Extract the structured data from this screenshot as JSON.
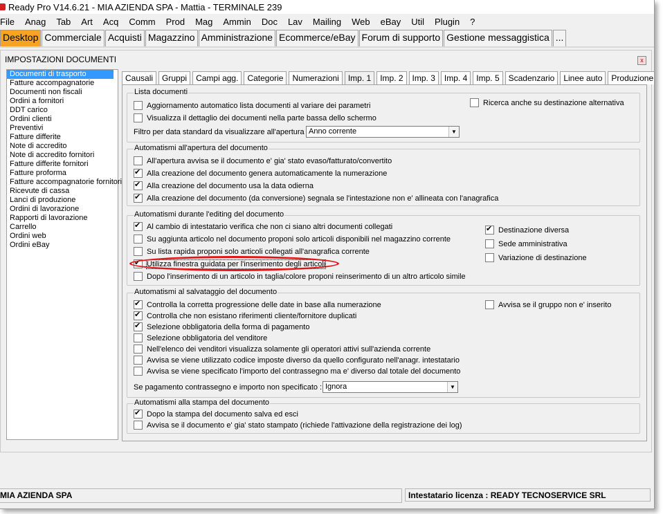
{
  "window": {
    "title": "Ready Pro V14.6.21 - MIA AZIENDA SPA - Mattia - TERMINALE 239"
  },
  "menu": [
    "File",
    "Anag",
    "Tab",
    "Art",
    "Acq",
    "Comm",
    "Prod",
    "Mag",
    "Ammin",
    "Doc",
    "Lav",
    "Mailing",
    "Web",
    "eBay",
    "Util",
    "Plugin",
    "?"
  ],
  "main_tabs": [
    "Desktop",
    "Commerciale",
    "Acquisti",
    "Magazzino",
    "Amministrazione",
    "Ecommerce/eBay",
    "Forum di supporto",
    "Gestione messaggistica",
    "..."
  ],
  "panel": {
    "title": "IMPOSTAZIONI DOCUMENTI",
    "close": "x"
  },
  "doc_types": [
    "Documenti di trasporto",
    "Fatture accompagnatorie",
    "Documenti non fiscali",
    "Ordini a fornitori",
    "DDT carico",
    "Ordini clienti",
    "Preventivi",
    "Fatture differite",
    "Note di accredito",
    "Note di accredito fornitori",
    "Fatture differite fornitori",
    "Fatture proforma",
    "Fatture accompagnatorie fornitori",
    "Ricevute di cassa",
    "Lanci di produzione",
    "Ordini di lavorazione",
    "Rapporti di lavorazione",
    "Carrello",
    "Ordini web",
    "Ordini eBay"
  ],
  "sub_tabs": [
    "Causali",
    "Gruppi",
    "Campi agg.",
    "Categorie",
    "Numerazioni",
    "Imp. 1",
    "Imp. 2",
    "Imp. 3",
    "Imp. 4",
    "Imp. 5",
    "Scadenzario",
    "Linee auto",
    "Produzione"
  ],
  "groups": {
    "lista": {
      "title": "Lista documenti",
      "items": [
        {
          "label": "Aggiornamento automatico lista documenti al variare dei parametri",
          "checked": false
        },
        {
          "label": "Visualizza il dettaglio dei documenti nella parte bassa dello schermo",
          "checked": false
        }
      ],
      "right": {
        "label": "Ricerca anche su destinazione alternativa",
        "checked": false
      },
      "filter_label": "Filtro per data standard da visualizzare all'apertura :",
      "filter_value": "Anno corrente"
    },
    "apertura": {
      "title": "Automatismi all'apertura del documento",
      "items": [
        {
          "label": "All'apertura avvisa se il documento e' gia' stato evaso/fatturato/convertito",
          "checked": false
        },
        {
          "label": "Alla creazione del documento genera automaticamente la numerazione",
          "checked": true
        },
        {
          "label": "Alla creazione del documento usa la data odierna",
          "checked": true
        },
        {
          "label": "Alla creazione del documento (da conversione) segnala se l'intestazione non e' allineata con l'anagrafica",
          "checked": true
        }
      ]
    },
    "editing": {
      "title": "Automatismi durante l'editing del documento",
      "items": [
        {
          "label": "Al cambio di intestatario verifica che non ci siano altri documenti collegati",
          "checked": true
        },
        {
          "label": "Su aggiunta articolo nel documento proponi solo articoli disponibili nel magazzino corrente",
          "checked": false
        },
        {
          "label": "Su lista rapida proponi solo articoli collegati all'anagrafica corrente",
          "checked": false
        },
        {
          "label": "Utilizza finestra guidata per l'inserimento degli articoli",
          "checked": true
        },
        {
          "label": "Dopo l'inserimento di un articolo in taglia/colore proponi reinserimento di un altro articolo simile",
          "checked": false
        }
      ],
      "right": [
        {
          "label": "Destinazione diversa",
          "checked": true
        },
        {
          "label": "Sede amministrativa",
          "checked": false
        },
        {
          "label": "Variazione di destinazione",
          "checked": false
        }
      ]
    },
    "salvataggio": {
      "title": "Automatismi al salvataggio del documento",
      "items": [
        {
          "label": "Controlla la corretta progressione delle date in base alla numerazione",
          "checked": true
        },
        {
          "label": "Controlla che non esistano riferimenti cliente/fornitore duplicati",
          "checked": true
        },
        {
          "label": "Selezione obbligatoria della forma di pagamento",
          "checked": true
        },
        {
          "label": "Selezione obbligatoria del venditore",
          "checked": false
        },
        {
          "label": "Nell'elenco dei venditori visualizza solamente gli operatori attivi sull'azienda corrente",
          "checked": false
        },
        {
          "label": "Avvisa se viene utilizzato codice imposte diverso da quello configurato nell'anagr. intestatario",
          "checked": false
        },
        {
          "label": "Avvisa se viene specificato l'importo del contrassegno ma e' diverso dal totale del documento",
          "checked": false
        }
      ],
      "right": {
        "label": "Avvisa se il gruppo non e' inserito",
        "checked": false
      },
      "pay_label": "Se pagamento contrassegno e importo non specificato :",
      "pay_value": "Ignora"
    },
    "stampa": {
      "title": "Automatismi alla stampa del documento",
      "items": [
        {
          "label": "Dopo la stampa del documento salva ed esci",
          "checked": true
        },
        {
          "label": "Avvisa se il documento e' gia' stato stampato (richiede l'attivazione della registrazione dei log)",
          "checked": false
        }
      ]
    }
  },
  "status": {
    "company": "MIA AZIENDA SPA",
    "license": "Intestatario licenza : READY TECNOSERVICE SRL"
  },
  "colors": {
    "active_tab": "#f7a323",
    "selection": "#3399ff",
    "highlight_ellipse": "#e21616"
  }
}
